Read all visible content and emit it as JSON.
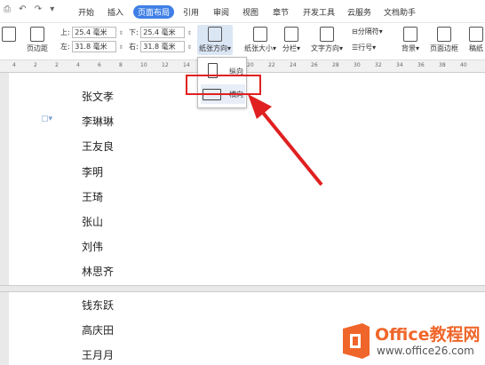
{
  "menubar": {
    "tabs": [
      "开始",
      "插入",
      "页面布局",
      "引用",
      "审阅",
      "视图",
      "章节",
      "开发工具",
      "云服务",
      "文档助手"
    ],
    "active": "页面布局"
  },
  "ribbon": {
    "page_margin": "页边距",
    "top_label": "上:",
    "top_value": "25.4 毫米",
    "bottom_label": "下:",
    "bottom_value": "25.4 毫米",
    "left_label": "左:",
    "left_value": "31.8 毫米",
    "right_label": "右:",
    "right_value": "31.8 毫米",
    "orientation": "纸张方向",
    "paper_size": "纸张大小",
    "columns": "分栏",
    "text_direction": "文字方向",
    "break": "分隔符",
    "line_number": "行号",
    "background": "背景",
    "page_border": "页面边框",
    "more": "稿纸"
  },
  "ruler": [
    "4",
    "2",
    "2",
    "4",
    "6",
    "8",
    "10",
    "12",
    "14",
    "16",
    "18",
    "20",
    "22",
    "24",
    "26",
    "28",
    "30",
    "32",
    "34",
    "36",
    "38",
    "40"
  ],
  "dropdown": {
    "portrait": "纵向",
    "landscape": "横向"
  },
  "names_page1": [
    "张文孝",
    "李琳琳",
    "王友良",
    "李明",
    "王琦",
    "张山",
    "刘伟",
    "林思齐"
  ],
  "names_page2": [
    "钱东跃",
    "高庆田",
    "王月月"
  ],
  "logo": {
    "brand": "Office教程网",
    "url": "www.office26.com"
  },
  "colors": {
    "accent": "#3f7fe6",
    "highlight": "#e02020",
    "logo_orange": "#f0662a"
  }
}
